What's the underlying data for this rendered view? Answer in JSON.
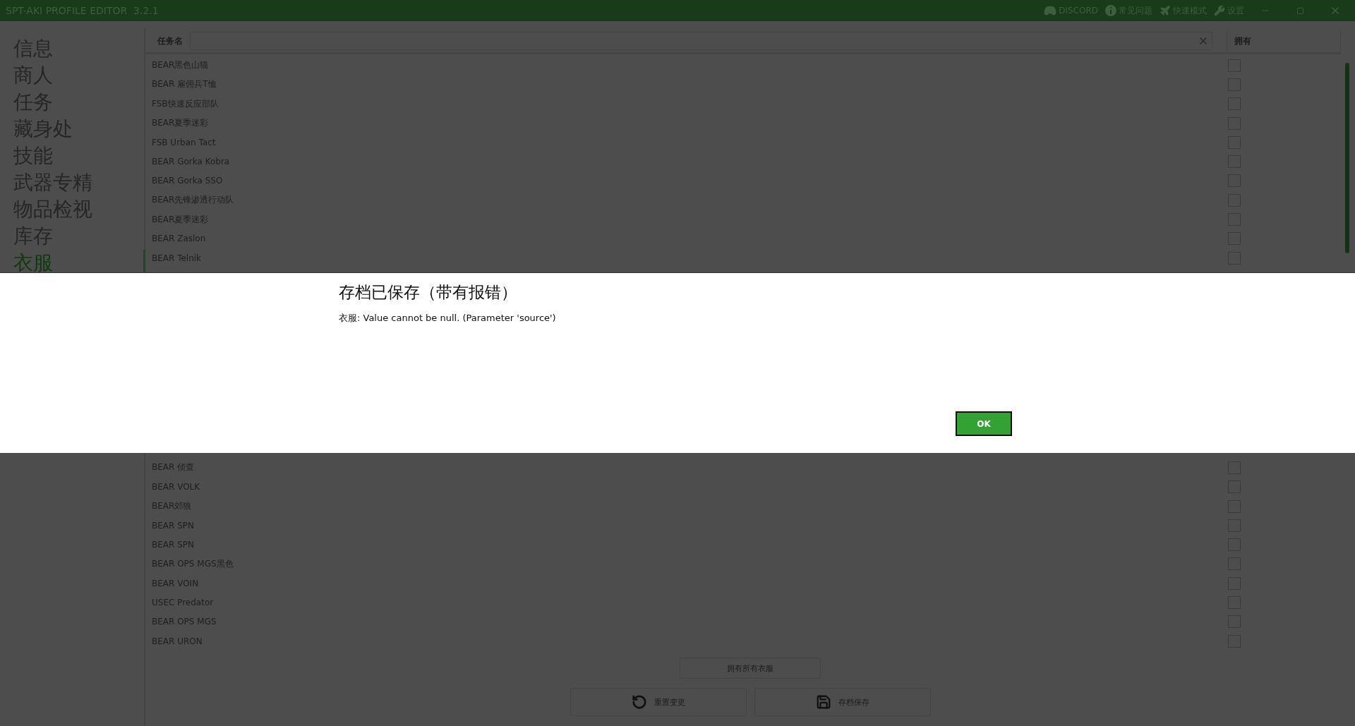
{
  "window": {
    "title": "SPT-AKI PROFILE EDITOR",
    "version": "3.2.1",
    "links": [
      {
        "kind": "discord",
        "label": "DISCORD"
      },
      {
        "kind": "info",
        "label": "常见问题"
      },
      {
        "kind": "plane",
        "label": "快速模式"
      },
      {
        "kind": "wrench",
        "label": "设置"
      }
    ]
  },
  "nav": [
    {
      "label": "信息",
      "selected": false
    },
    {
      "label": "商人",
      "selected": false
    },
    {
      "label": "任务",
      "selected": false
    },
    {
      "label": "藏身处",
      "selected": false
    },
    {
      "label": "技能",
      "selected": false
    },
    {
      "label": "武器专精",
      "selected": false
    },
    {
      "label": "物品检视",
      "selected": false
    },
    {
      "label": "库存",
      "selected": false
    },
    {
      "label": "衣服",
      "selected": true
    }
  ],
  "table": {
    "filter_label": "任务名",
    "owned_column": "拥有",
    "rows_above": [
      {
        "name": "BEAR黑色山猫",
        "checked": false
      },
      {
        "name": "BEAR 雇佣兵T恤",
        "checked": false
      },
      {
        "name": "FSB快速反应部队",
        "checked": false
      },
      {
        "name": "BEAR夏季迷彩",
        "checked": false
      },
      {
        "name": "FSB Urban Tact",
        "checked": false
      },
      {
        "name": "BEAR Gorka Kobra",
        "checked": false
      },
      {
        "name": "BEAR Gorka SSO",
        "checked": false
      },
      {
        "name": "BEAR先锋渗透行动队",
        "checked": false
      },
      {
        "name": "BEAR夏季迷彩",
        "checked": false
      },
      {
        "name": "BEAR Zaslon",
        "checked": false
      },
      {
        "name": "BEAR Telnik",
        "checked": false
      }
    ],
    "rows_below": [
      {
        "name": "BEAR 侦查",
        "checked": false
      },
      {
        "name": "BEAR VOLK",
        "checked": false
      },
      {
        "name": "BEAR郊狼",
        "checked": false
      },
      {
        "name": "BEAR SPN",
        "checked": false
      },
      {
        "name": "BEAR SPN",
        "checked": false
      },
      {
        "name": "BEAR OPS MGS黑色",
        "checked": false
      },
      {
        "name": "BEAR VOIN",
        "checked": false
      },
      {
        "name": "USEC Predator",
        "checked": false
      },
      {
        "name": "BEAR OPS MGS",
        "checked": false
      },
      {
        "name": "BEAR URON",
        "checked": false
      }
    ]
  },
  "own_all_button": "拥有所有衣服",
  "actions": [
    {
      "kind": "undo",
      "label": "重置变更"
    },
    {
      "kind": "save",
      "label": "存档保存"
    }
  ],
  "dialog": {
    "title": "存档已保存（带有报错）",
    "message": "衣服: Value cannot be null. (Parameter 'source')",
    "button": "OK"
  }
}
